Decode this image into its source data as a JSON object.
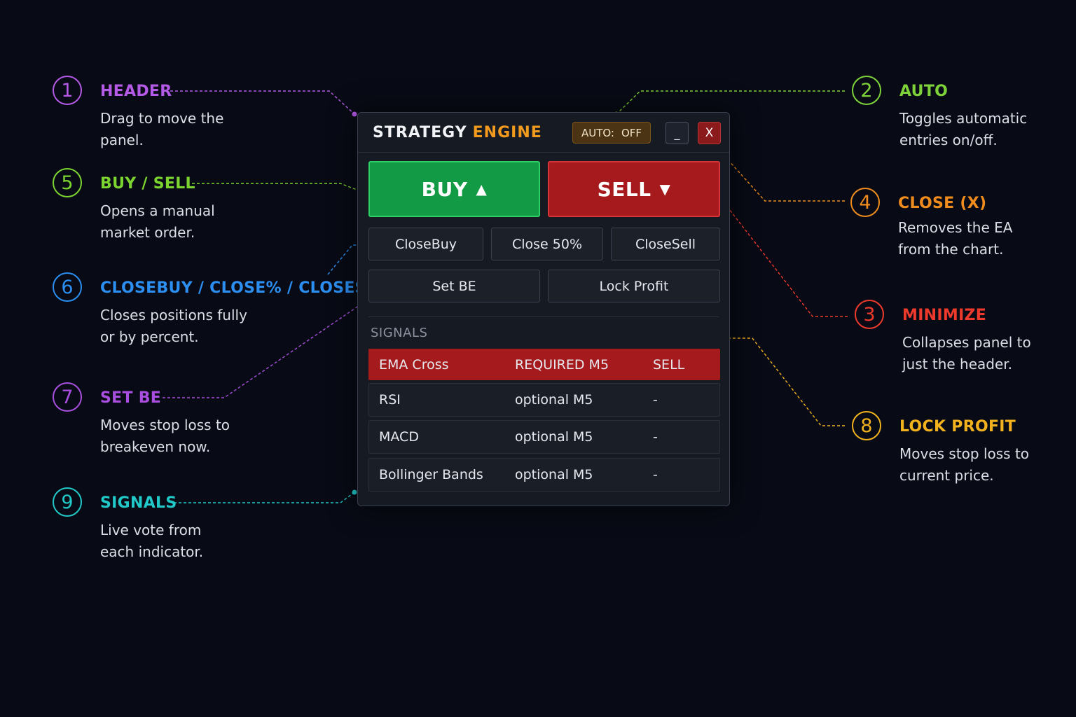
{
  "panel": {
    "title_part1": "STRATEGY",
    "title_part2": "ENGINE",
    "auto_label": "AUTO:",
    "auto_state": "OFF",
    "minimize_label": "_",
    "close_label": "X",
    "buy_label": "BUY",
    "buy_arrow": "▲",
    "sell_label": "SELL",
    "sell_arrow": "▼",
    "close_buy": "CloseBuy",
    "close_50": "Close 50%",
    "close_sell": "CloseSell",
    "set_be": "Set BE",
    "lock_profit": "Lock Profit",
    "signals_label": "SIGNALS",
    "signals": [
      {
        "name": "EMA Cross",
        "requirement": "REQUIRED M5",
        "vote": "SELL"
      },
      {
        "name": "RSI",
        "requirement": "optional M5",
        "vote": "-"
      },
      {
        "name": "MACD",
        "requirement": "optional M5",
        "vote": "-"
      },
      {
        "name": "Bollinger Bands",
        "requirement": "optional M5",
        "vote": "-"
      }
    ]
  },
  "callouts": [
    {
      "num": "1",
      "title": "HEADER",
      "desc": "Drag to move the panel.",
      "color": "#b45ae6"
    },
    {
      "num": "5",
      "title": "BUY / SELL",
      "desc": "Opens a manual market order.",
      "color": "#7cd430"
    },
    {
      "num": "6",
      "title": "CLOSEBUY / CLOSE% / CLOSESELL",
      "desc": "Closes positions fully or by percent.",
      "color": "#2b8ef0"
    },
    {
      "num": "7",
      "title": "SET BE",
      "desc": "Moves stop loss to breakeven now.",
      "color": "#a84fe0"
    },
    {
      "num": "9",
      "title": "SIGNALS",
      "desc": "Live vote from each indicator.",
      "color": "#21c9c9"
    },
    {
      "num": "2",
      "title": "AUTO",
      "desc": "Toggles automatic entries on/off.",
      "color": "#7ed33a"
    },
    {
      "num": "4",
      "title": "CLOSE (X)",
      "desc": "Removes the EA from the chart.",
      "color": "#f08c1e"
    },
    {
      "num": "3",
      "title": "MINIMIZE",
      "desc": "Collapses panel to just the header.",
      "color": "#ee3a2c"
    },
    {
      "num": "8",
      "title": "LOCK PROFIT",
      "desc": "Moves stop loss to current price.",
      "color": "#f2b21e"
    }
  ]
}
